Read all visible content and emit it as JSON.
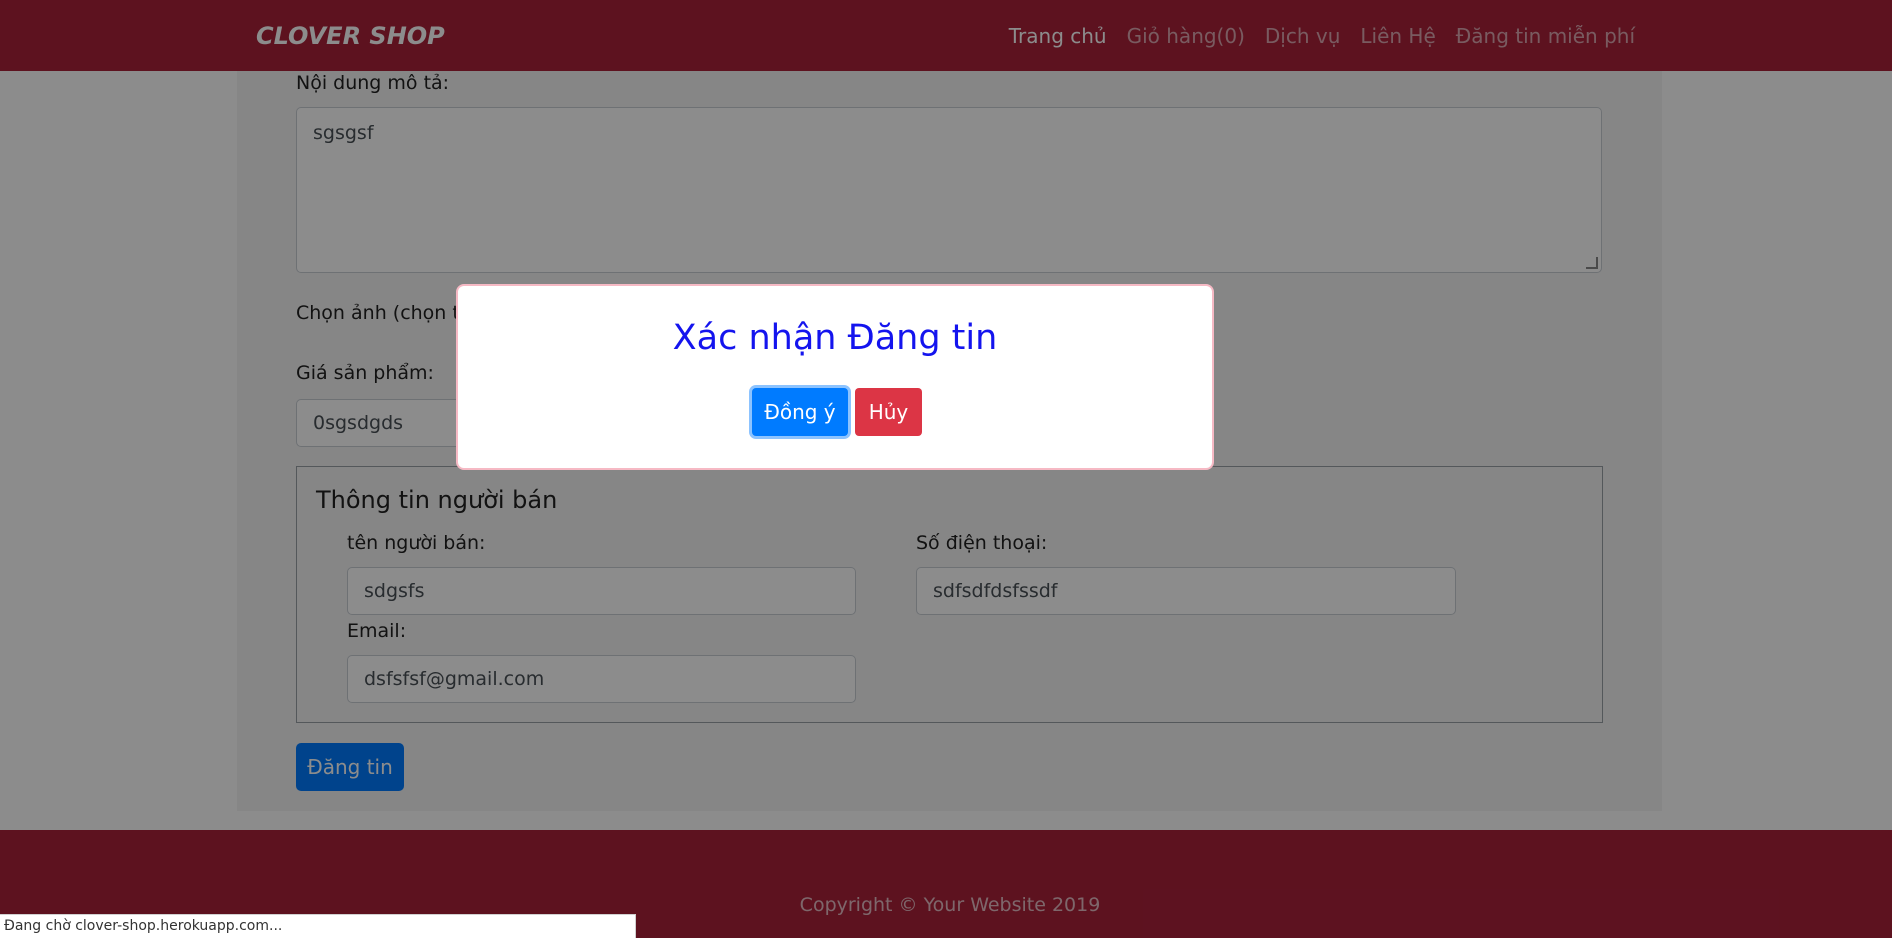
{
  "navbar": {
    "brand": "CLOVER SHOP",
    "links": [
      "Trang chủ",
      "Giỏ hàng(0)",
      "Dịch vụ",
      "Liên Hệ",
      "Đăng tin miễn phí"
    ]
  },
  "form": {
    "description_label": "Nội dung mô tả:",
    "description_value": "sgsgsf",
    "image_label": "Chọn ảnh (chọn tố",
    "price_label": "Giá sản phẩm:",
    "price_value": "0sgsdgds",
    "seller_section": {
      "title": "Thông tin người bán",
      "name_label": "tên người bán:",
      "name_value": "sdgsfs",
      "phone_label": "Số điện thoại:",
      "phone_value": "sdfsdfdsfssdf",
      "email_label": "Email:",
      "email_value": "dsfsfsf@gmail.com"
    },
    "submit_label": "Đăng tin"
  },
  "modal": {
    "title": "Xác nhận Đăng tin",
    "confirm_label": "Đồng ý",
    "cancel_label": "Hủy"
  },
  "footer": {
    "copyright": "Copyright © Your Website 2019"
  },
  "status_bar": {
    "text": "Đang chờ clover-shop.herokuapp.com..."
  },
  "colors": {
    "brand": "#a9213a",
    "primary": "#007bff",
    "danger": "#dc3545",
    "modal_title": "#1414ee"
  }
}
